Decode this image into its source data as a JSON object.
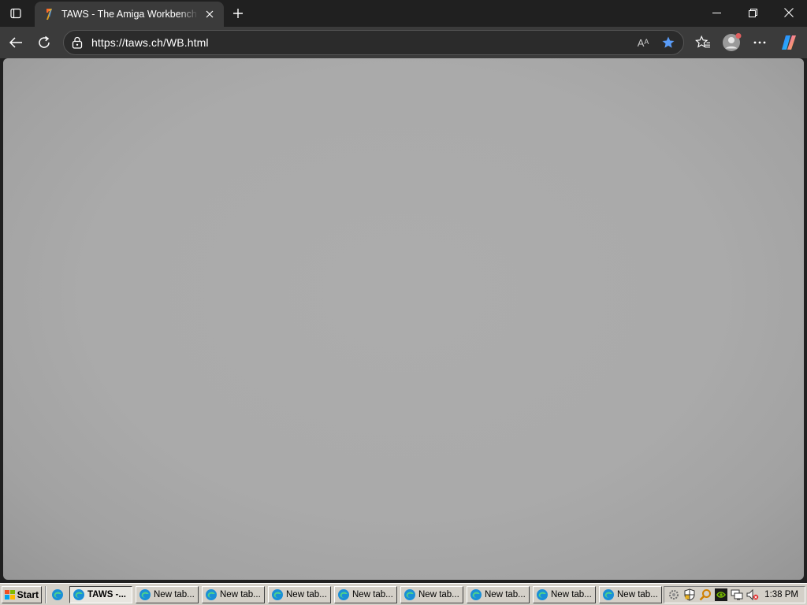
{
  "browser": {
    "tab": {
      "title": "TAWS - The Amiga Workbench Site",
      "favicon": "taws-favicon"
    },
    "address": {
      "url": "https://taws.ch/WB.html"
    },
    "icons": [
      "tab-actions-icon",
      "close-icon",
      "new-tab-icon",
      "minimize-icon",
      "restore-icon",
      "close-window-icon",
      "back-icon",
      "reload-icon",
      "site-info-icon",
      "read-aloud-icon",
      "favorite-star-icon",
      "favorites-icon",
      "profile-icon",
      "more-icon",
      "copilot-icon"
    ],
    "read_aloud_label": "Aᴬ"
  },
  "page": {
    "background": "#aaaaaa"
  },
  "taskbar": {
    "start_label": "Start",
    "tasks": [
      {
        "label": "TAWS -...",
        "active": true
      },
      {
        "label": "New tab..."
      },
      {
        "label": "New tab..."
      },
      {
        "label": "New tab..."
      },
      {
        "label": "New tab..."
      },
      {
        "label": "New tab..."
      },
      {
        "label": "New tab..."
      },
      {
        "label": "New tab..."
      },
      {
        "label": "New tab..."
      }
    ],
    "tray_icons": [
      "settings-icon",
      "shield-icon",
      "search-icon",
      "nvidia-icon",
      "network-icon",
      "volume-muted-icon"
    ],
    "clock": "1:38 PM"
  },
  "colors": {
    "chrome_dark": "#202020",
    "toolbar": "#3b3b3b",
    "accent_star": "#5a9cf8",
    "taskbar": "#d4d0c8"
  }
}
